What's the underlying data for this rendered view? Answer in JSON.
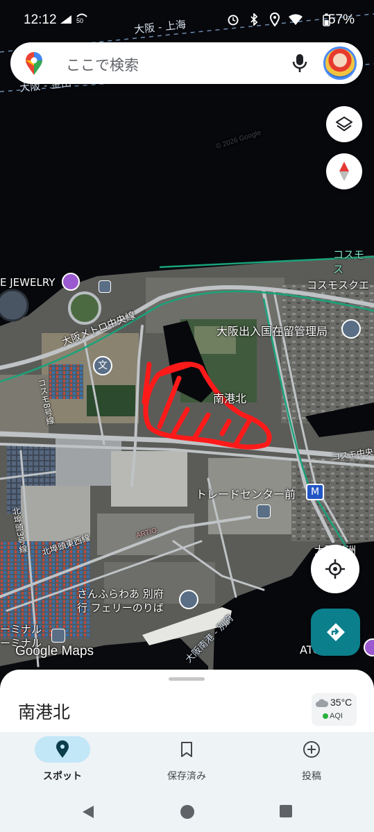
{
  "status_bar": {
    "time": "12:12",
    "network_speed": "50",
    "battery_percent": "57%",
    "icons": [
      "cell-signal-icon",
      "data-speed-icon",
      "alarm-icon",
      "bluetooth-icon",
      "location-icon",
      "wifi-icon",
      "battery-icon"
    ]
  },
  "search": {
    "placeholder": "ここで検索",
    "icons": [
      "maps-pin-icon",
      "microphone-icon",
      "account-avatar"
    ]
  },
  "map": {
    "type": "satellite",
    "colors": {
      "water": "#07080c",
      "land": "#5b5c58",
      "road": "#bfc3c6",
      "rail": "#1aa37a",
      "annotation": "#ff1a1a"
    },
    "labels": {
      "ferry_osaka_shanghai": "大阪 - 上海",
      "ferry_osaka_kanda": "大阪 - 金田",
      "cosmo_top": "コスモス",
      "jewelry": "E JEWELRY",
      "cosmo_square": "コスモスクエ",
      "immigration": "大阪出入国在留管理局",
      "metro_chuo_line": "大阪メトロ中央線",
      "cosmo_8": "コスモ8号線",
      "nankoukita": "南港北",
      "cosmo_chuo": "コスモ中央",
      "trade_center": "トレードセンター前",
      "kita_futou_3": "北埠頭3号線",
      "kita_futou_higashi": "北埠頭東西線",
      "sakishima": "大阪咲洲",
      "sunflower_line1": "さんふらわあ 別府",
      "sunflower_line2": "行 フェリーのりば",
      "terminal1": "ーミナル",
      "terminal2": "ーミナル",
      "osaka_nanko_beppu": "大阪南港 - 別府",
      "atc": "ATC",
      "watermark": "Google Maps",
      "copyright": "© 2026 Google",
      "art_building": "ARTIO"
    },
    "controls": [
      "layers-icon",
      "compass-icon",
      "my-location-icon",
      "directions-icon"
    ]
  },
  "sheet": {
    "place_name": "南港北",
    "weather": {
      "temperature": "35°C",
      "aqi_label": "AQI",
      "aqi_color": "#27b33d"
    }
  },
  "bottom_nav": {
    "items": [
      {
        "label": "スポット",
        "icon": "place-pin-icon",
        "active": true
      },
      {
        "label": "保存済み",
        "icon": "bookmark-icon",
        "active": false
      },
      {
        "label": "投稿",
        "icon": "add-circle-icon",
        "active": false
      }
    ],
    "active_color": "#c2e7f7"
  },
  "system_nav": [
    "back-icon",
    "home-icon",
    "recents-icon"
  ]
}
